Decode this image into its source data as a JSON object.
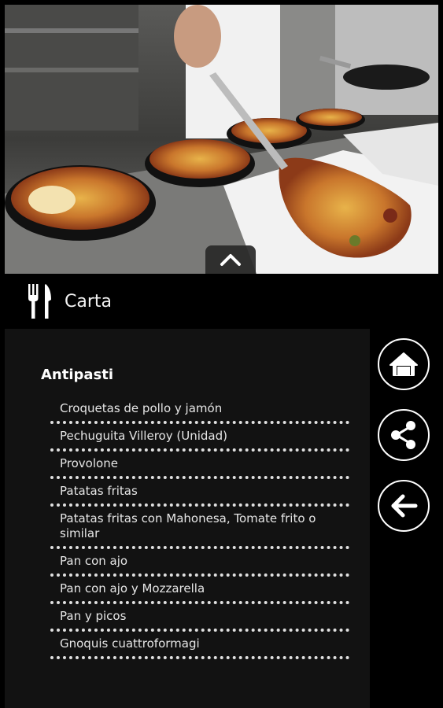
{
  "hero": {
    "image_desc_icon": "pizza-kitchen-photo",
    "collapse_icon": "chevron-up-icon"
  },
  "header": {
    "icon": "fork-knife-icon",
    "title": "Carta"
  },
  "menu": {
    "section_title": "Antipasti",
    "items": [
      {
        "label": "Croquetas de pollo y jamón"
      },
      {
        "label": "Pechuguita Villeroy (Unidad)"
      },
      {
        "label": "Provolone"
      },
      {
        "label": "Patatas fritas"
      },
      {
        "label": "Patatas fritas con Mahonesa, Tomate frito o similar"
      },
      {
        "label": "Pan con ajo"
      },
      {
        "label": "Pan con ajo y Mozzarella"
      },
      {
        "label": "Pan y picos"
      },
      {
        "label": "Gnoquis cuattroformagi"
      }
    ]
  },
  "side_buttons": [
    {
      "icon": "home-icon"
    },
    {
      "icon": "share-icon"
    },
    {
      "icon": "back-arrow-icon"
    }
  ],
  "colors": {
    "background": "#000000",
    "panel": "#121212",
    "text": "#ffffff"
  }
}
